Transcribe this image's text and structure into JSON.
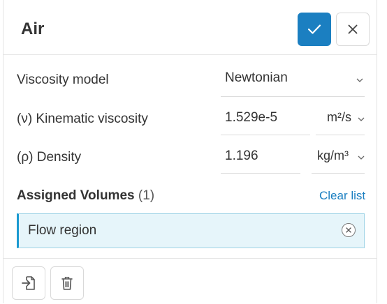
{
  "panel": {
    "title": "Air",
    "confirm_icon": "checkmark-icon",
    "close_icon": "close-icon"
  },
  "properties": {
    "viscosity_model": {
      "label": "Viscosity model",
      "value": "Newtonian"
    },
    "kinematic_viscosity": {
      "label": "(ν) Kinematic viscosity",
      "value": "1.529e-5",
      "unit": "m²/s"
    },
    "density": {
      "label": "(ρ) Density",
      "value": "1.196",
      "unit": "kg/m³"
    }
  },
  "assigned_volumes": {
    "label": "Assigned Volumes",
    "count": "(1)",
    "clear_label": "Clear list",
    "items": [
      {
        "name": "Flow region"
      }
    ]
  },
  "footer": {
    "import_icon": "import-icon",
    "delete_icon": "trash-icon"
  },
  "colors": {
    "accent": "#1b7fc1",
    "selected_background": "#e6f5fa",
    "selected_border": "#1b9ad1"
  }
}
